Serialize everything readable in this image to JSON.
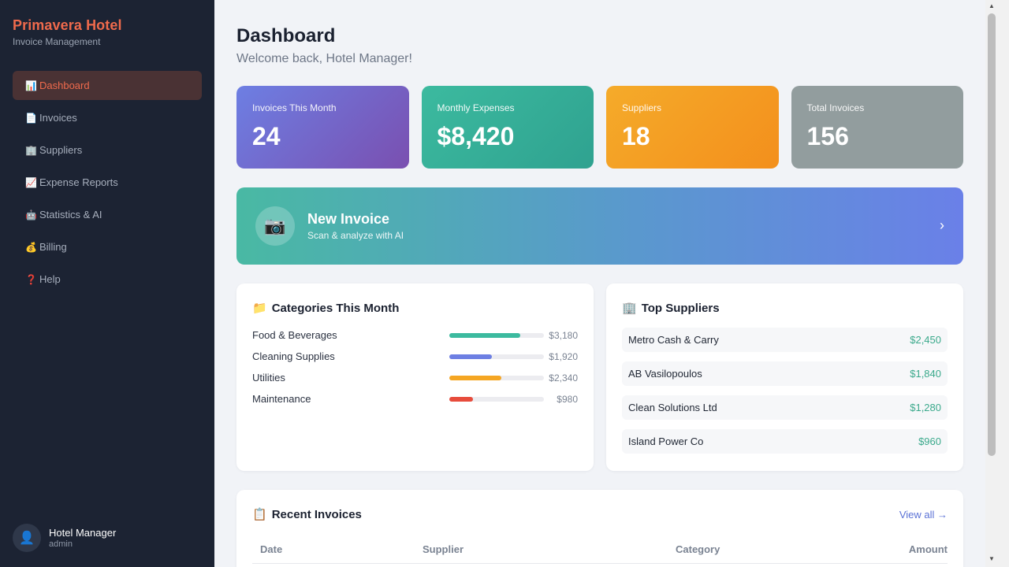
{
  "sidebar": {
    "brand_title": "Primavera Hotel",
    "brand_sub": "Invoice Management",
    "items": [
      {
        "icon": "📊",
        "label": "Dashboard"
      },
      {
        "icon": "📄",
        "label": "Invoices"
      },
      {
        "icon": "🏢",
        "label": "Suppliers"
      },
      {
        "icon": "📈",
        "label": "Expense Reports"
      },
      {
        "icon": "🤖",
        "label": "Statistics & AI"
      },
      {
        "icon": "💰",
        "label": "Billing"
      },
      {
        "icon": "❓",
        "label": "Help"
      }
    ],
    "user": {
      "avatar": "👤",
      "name": "Hotel Manager",
      "role": "admin"
    }
  },
  "header": {
    "title": "Dashboard",
    "subtitle": "Welcome back, Hotel Manager!"
  },
  "stats": [
    {
      "label": "Invoices This Month",
      "value": "24"
    },
    {
      "label": "Monthly Expenses",
      "value": "$8,420"
    },
    {
      "label": "Suppliers",
      "value": "18"
    },
    {
      "label": "Total Invoices",
      "value": "156"
    }
  ],
  "banner": {
    "icon": "📷",
    "title": "New Invoice",
    "subtitle": "Scan & analyze with AI",
    "chevron": "›"
  },
  "categories": {
    "icon": "📁",
    "title": "Categories This Month",
    "items": [
      {
        "name": "Food & Beverages",
        "amount": "$3,180",
        "fill": 0.75,
        "color": "#3cba9f"
      },
      {
        "name": "Cleaning Supplies",
        "amount": "$1,920",
        "fill": 0.45,
        "color": "#6d7fe3"
      },
      {
        "name": "Utilities",
        "amount": "$2,340",
        "fill": 0.55,
        "color": "#f5a623"
      },
      {
        "name": "Maintenance",
        "amount": "$980",
        "fill": 0.25,
        "color": "#e74c3c"
      }
    ]
  },
  "suppliers": {
    "icon": "🏢",
    "title": "Top Suppliers",
    "items": [
      {
        "name": "Metro Cash & Carry",
        "amount": "$2,450"
      },
      {
        "name": "AB Vasilopoulos",
        "amount": "$1,840"
      },
      {
        "name": "Clean Solutions Ltd",
        "amount": "$1,280"
      },
      {
        "name": "Island Power Co",
        "amount": "$960"
      }
    ]
  },
  "recent": {
    "icon": "📋",
    "title": "Recent Invoices",
    "view_all": "View all →",
    "columns": [
      "Date",
      "Supplier",
      "Category",
      "Amount"
    ]
  },
  "scrollbar": {
    "up": "▲",
    "down": "▼"
  }
}
